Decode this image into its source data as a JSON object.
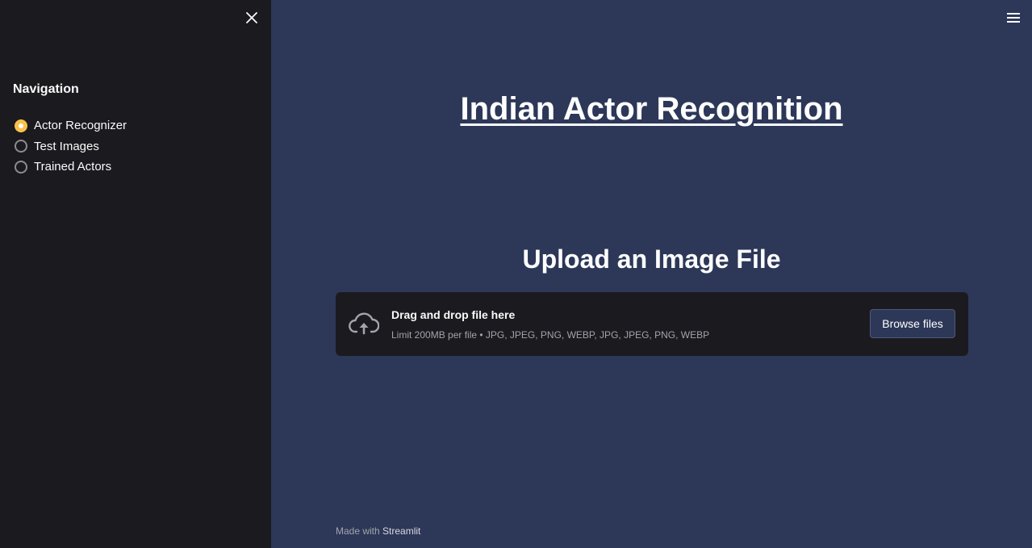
{
  "sidebar": {
    "close_icon": "close-icon",
    "nav_title": "Navigation",
    "options": [
      {
        "label": "Actor Recognizer",
        "selected": true
      },
      {
        "label": "Test Images",
        "selected": false
      },
      {
        "label": "Trained Actors",
        "selected": false
      }
    ]
  },
  "header": {
    "menu_icon": "hamburger-menu-icon"
  },
  "main": {
    "title": "Indian Actor Recognition",
    "subheading": "Upload an Image File",
    "uploader": {
      "icon": "cloud-upload-icon",
      "title": "Drag and drop file here",
      "limit": "Limit 200MB per file • JPG, JPEG, PNG, WEBP, JPG, JPEG, PNG, WEBP",
      "button_label": "Browse files"
    }
  },
  "footer": {
    "prefix": "Made with ",
    "brand": "Streamlit"
  },
  "colors": {
    "accent": "#f9c14a",
    "main_bg": "#2d3858",
    "sidebar_bg": "#1b1a1f"
  }
}
